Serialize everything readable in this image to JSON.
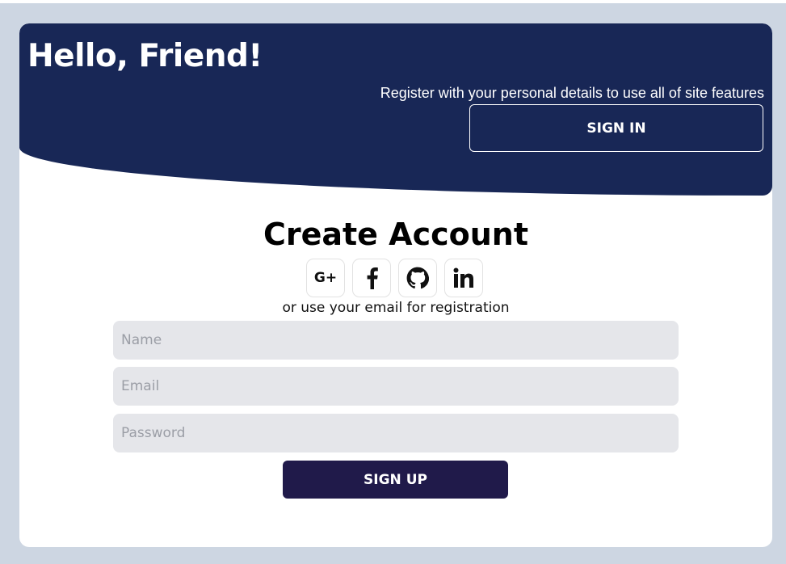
{
  "banner": {
    "greeting": "Hello, Friend!",
    "subtitle": "Register with your personal details to use all of site features",
    "signin_label": "SIGN IN"
  },
  "form": {
    "title": "Create Account",
    "socials": [
      {
        "icon": "google-plus-icon",
        "label": "G+"
      },
      {
        "icon": "facebook-icon"
      },
      {
        "icon": "github-icon"
      },
      {
        "icon": "linkedin-icon",
        "label": "in"
      }
    ],
    "alt_text": "or use your email for registration",
    "name_placeholder": "Name",
    "email_placeholder": "Email",
    "password_placeholder": "Password",
    "signup_label": "SIGN UP"
  },
  "colors": {
    "background": "#cdd6e2",
    "banner": "#182756",
    "input_bg": "#e5e6ea",
    "signup_button": "#201a4a"
  }
}
